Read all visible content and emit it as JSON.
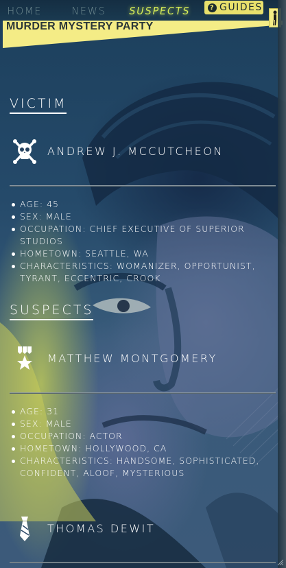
{
  "nav": {
    "items": [
      {
        "label": "Home",
        "active": false
      },
      {
        "label": "News",
        "active": false
      },
      {
        "label": "Suspects",
        "active": true
      }
    ],
    "guides_label": "Guides",
    "guides_icon": "help-circle-icon"
  },
  "banner": {
    "title": "Murder Mystery Party"
  },
  "victim": {
    "heading": "Victim",
    "icon": "skull-crossbones-icon",
    "name": "Andrew J. McCutcheon",
    "facts": [
      "Age: 45",
      "Sex: Male",
      "Occupation: Chief Executive of Superior Studios",
      "Hometown: Seattle, WA",
      "Characteristics: Womanizer, Opportunist, Tyrant, Eccentric, Crook"
    ]
  },
  "suspects": {
    "heading": "Suspects",
    "list": [
      {
        "icon": "medal-icon",
        "name": "Matthew Montgomery",
        "facts": [
          "Age: 31",
          "Sex: Male",
          "Occupation: Actor",
          "Hometown: Hollywood, CA",
          "Characteristics: Handsome, Sophisticated, Confident, Aloof, Mysterious"
        ]
      },
      {
        "icon": "necktie-icon",
        "name": "Thomas Dewit"
      }
    ]
  },
  "colors": {
    "accent": "#d6ec57",
    "banner": "#f4ec86",
    "text": "#ffffff"
  }
}
